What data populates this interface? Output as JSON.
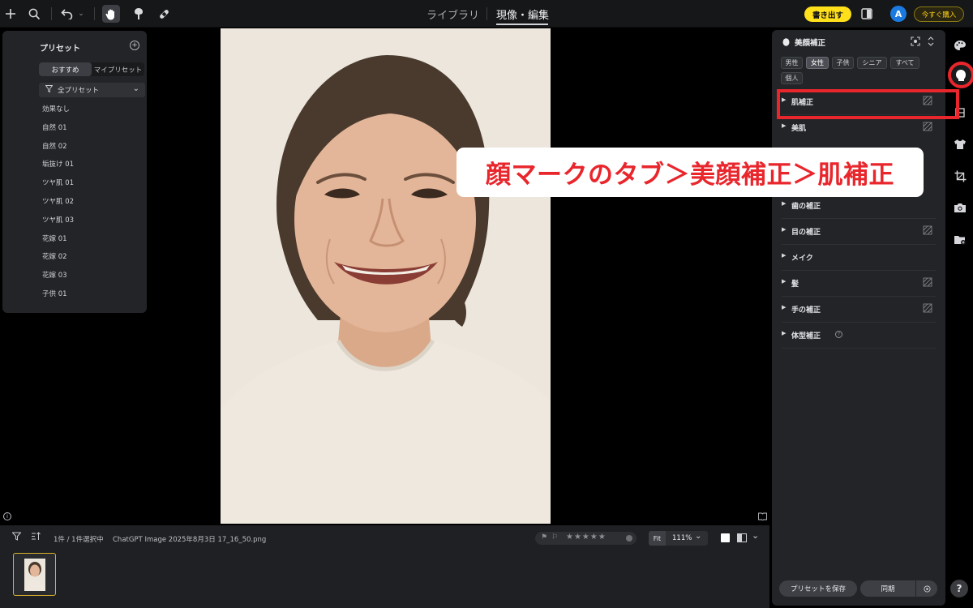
{
  "topbar": {
    "nav_tabs": [
      "ライブラリ",
      "現像・編集"
    ],
    "active_tab": "現像・編集",
    "export_label": "書き出す",
    "avatar_initial": "A",
    "buy_label": "今すぐ購入"
  },
  "presets": {
    "title": "プリセット",
    "tabs": [
      "おすすめ",
      "マイプリセット"
    ],
    "active_tab": "おすすめ",
    "filter_value": "全プリセット",
    "items": [
      "効果なし",
      "自然 01",
      "自然 02",
      "垢抜け 01",
      "ツヤ肌 01",
      "ツヤ肌 02",
      "ツヤ肌 03",
      "花嫁 01",
      "花嫁 02",
      "花嫁 03",
      "子供 01"
    ]
  },
  "filmstrip": {
    "count_text": "1件 / 1件選択中",
    "filename": "ChatGPT Image 2025年8月3日 17_16_50.png",
    "fit_label": "Fit",
    "zoom_value": "111%",
    "rating_stars": 0
  },
  "beauty_panel": {
    "title": "美顔補正",
    "chips": [
      "男性",
      "女性",
      "子供",
      "シニア",
      "すべて",
      "個人"
    ],
    "active_chip": "女性",
    "sections": [
      "肌補正",
      "美肌",
      "歯の補正",
      "目の補正",
      "メイク",
      "髪",
      "手の補正",
      "体型補正"
    ],
    "save_preset_label": "プリセットを保存",
    "sync_label": "同期"
  },
  "annotation": {
    "callout_text": "顔マークのタブ＞美顔補正＞肌補正",
    "highlight_color": "#e8262c"
  },
  "help_label": "?"
}
